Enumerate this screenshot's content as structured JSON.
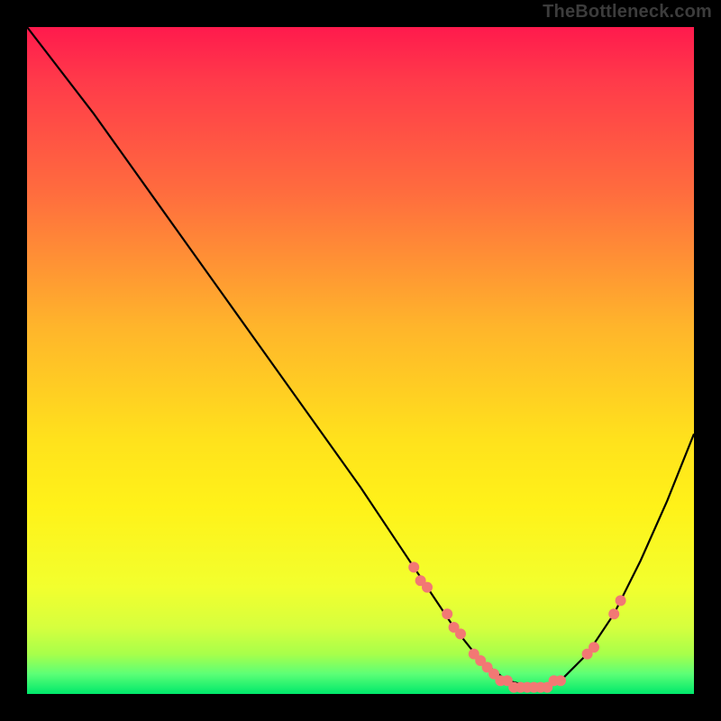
{
  "attribution": "TheBottleneck.com",
  "chart_data": {
    "type": "line",
    "title": "",
    "xlabel": "",
    "ylabel": "",
    "xlim": [
      0,
      100
    ],
    "ylim": [
      0,
      100
    ],
    "curve": {
      "x": [
        0,
        10,
        20,
        30,
        40,
        50,
        56,
        60,
        64,
        68,
        72,
        76,
        80,
        84,
        88,
        92,
        96,
        100
      ],
      "y": [
        100,
        87,
        73,
        59,
        45,
        31,
        22,
        16,
        10,
        5,
        2,
        1,
        2,
        6,
        12,
        20,
        29,
        39
      ]
    },
    "markers": [
      {
        "x": 58,
        "y": 19
      },
      {
        "x": 59,
        "y": 17
      },
      {
        "x": 60,
        "y": 16
      },
      {
        "x": 63,
        "y": 12
      },
      {
        "x": 64,
        "y": 10
      },
      {
        "x": 65,
        "y": 9
      },
      {
        "x": 67,
        "y": 6
      },
      {
        "x": 68,
        "y": 5
      },
      {
        "x": 69,
        "y": 4
      },
      {
        "x": 70,
        "y": 3
      },
      {
        "x": 71,
        "y": 2
      },
      {
        "x": 72,
        "y": 2
      },
      {
        "x": 73,
        "y": 1
      },
      {
        "x": 74,
        "y": 1
      },
      {
        "x": 75,
        "y": 1
      },
      {
        "x": 76,
        "y": 1
      },
      {
        "x": 77,
        "y": 1
      },
      {
        "x": 78,
        "y": 1
      },
      {
        "x": 79,
        "y": 2
      },
      {
        "x": 80,
        "y": 2
      },
      {
        "x": 84,
        "y": 6
      },
      {
        "x": 85,
        "y": 7
      },
      {
        "x": 88,
        "y": 12
      },
      {
        "x": 89,
        "y": 14
      }
    ],
    "marker_color": "#f27874",
    "line_color": "#000000"
  }
}
